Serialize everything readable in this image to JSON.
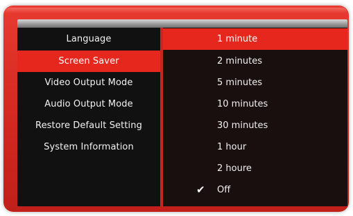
{
  "settings_menu": {
    "items": [
      {
        "label": "Language"
      },
      {
        "label": "Screen Saver"
      },
      {
        "label": "Video Output Mode"
      },
      {
        "label": "Audio Output Mode"
      },
      {
        "label": "Restore Default Setting"
      },
      {
        "label": "System Information"
      }
    ],
    "selected_label": "Screen Saver"
  },
  "screen_saver_options": {
    "items": [
      {
        "label": "1 minute"
      },
      {
        "label": "2 minutes"
      },
      {
        "label": "5 minutes"
      },
      {
        "label": "10 minutes"
      },
      {
        "label": "30 minutes"
      },
      {
        "label": "1 hour"
      },
      {
        "label": "2 houre"
      },
      {
        "label": "Off"
      }
    ],
    "highlighted_label": "1 minute",
    "checked_label": "Off",
    "check_icon": "checkmark-icon"
  },
  "colors": {
    "frame_red": "#d42a22",
    "selection_red": "#e5271d",
    "panel_black": "#111111"
  }
}
